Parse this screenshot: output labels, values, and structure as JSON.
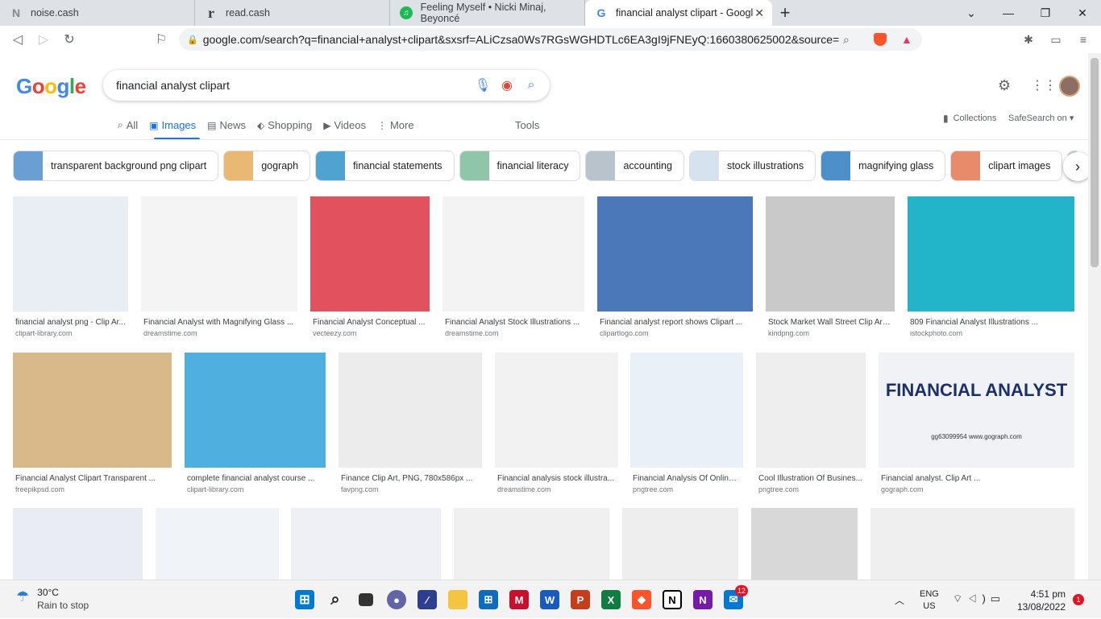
{
  "tabs": [
    {
      "title": "noise.cash",
      "icon": "N"
    },
    {
      "title": "read.cash",
      "icon": "r"
    },
    {
      "title": "Feeling Myself • Nicki Minaj, Beyoncé",
      "icon": "♫"
    },
    {
      "title": "financial analyst clipart - Google S",
      "icon": "G"
    }
  ],
  "url": "google.com/search?q=financial+analyst+clipart&sxsrf=ALiCzsa0Ws7RGsWGHDTLc6EA3gI9jFNEyQ:1660380625002&source=...",
  "search": {
    "logo": "Google",
    "query": "financial analyst clipart"
  },
  "nav": {
    "all": "All",
    "images": "Images",
    "news": "News",
    "shopping": "Shopping",
    "videos": "Videos",
    "more": "More",
    "tools": "Tools"
  },
  "collections": "Collections",
  "safesearch": "SafeSearch on",
  "chips": [
    {
      "label": "transparent background png clipart",
      "color": "#6a9fd4"
    },
    {
      "label": "gograph",
      "color": "#e9b872"
    },
    {
      "label": "financial statements",
      "color": "#4fa3d1"
    },
    {
      "label": "financial literacy",
      "color": "#8fc6a9"
    },
    {
      "label": "accounting",
      "color": "#b9c3cc"
    },
    {
      "label": "stock illustrations",
      "color": "#d6e3ef"
    },
    {
      "label": "magnifying glass",
      "color": "#4c8fc9"
    },
    {
      "label": "clipart images",
      "color": "#e88b6a"
    },
    {
      "label": "",
      "color": "#c8d4dc"
    }
  ],
  "row1": [
    {
      "title": "financial analyst png - Clip Ar...",
      "site": "clipart-library.com",
      "color": "#e8eef3"
    },
    {
      "title": "Financial Analyst with Magnifying Glass ...",
      "site": "dreamstime.com",
      "color": "#f4f4f4"
    },
    {
      "title": "Financial Analyst Conceptual ...",
      "site": "vecteezy.com",
      "color": "#e2525e"
    },
    {
      "title": "Financial Analyst Stock Illustrations ...",
      "site": "dreamstime.com",
      "color": "#f3f3f3"
    },
    {
      "title": "Financial analyst report shows Clipart ...",
      "site": "clipartlogo.com",
      "color": "#4a78b8"
    },
    {
      "title": "Stock Market Wall Street Clip Art,...",
      "site": "kindpng.com",
      "color": "#c9c9c9"
    },
    {
      "title": "809 Financial Analyst Illustrations ...",
      "site": "istockphoto.com",
      "color": "#22b5c9"
    }
  ],
  "row2": [
    {
      "title": "Financial Analyst Clipart Transparent ...",
      "site": "freepikpsd.com",
      "color": "#d9b98a"
    },
    {
      "title": "complete financial analyst course ...",
      "site": "clipart-library.com",
      "color": "#4fb0e0"
    },
    {
      "title": "Finance Clip Art, PNG, 780x586px ...",
      "site": "favpng.com",
      "color": "#ececec"
    },
    {
      "title": "Financial analysis stock illustra...",
      "site": "dreamstime.com",
      "color": "#f2f2f2"
    },
    {
      "title": "Financial Analysis Of Online ...",
      "site": "pngtree.com",
      "color": "#e9f0f7"
    },
    {
      "title": "Cool Illustration Of Busines...",
      "site": "pngtree.com",
      "color": "#eeeeee"
    },
    {
      "title": "Financial analyst. Clip Art ...",
      "site": "gograph.com",
      "color": "#f0f2f6",
      "caption": "FINANCIAL ANALYST",
      "stamp": "gg63099954 www.gograph.com"
    }
  ],
  "row3": [
    {
      "color": "#e9ecf5"
    },
    {
      "color": "#f0f4f8"
    },
    {
      "color": "#eef0f5"
    },
    {
      "color": "#f0f0f0"
    },
    {
      "color": "#eeeeee"
    },
    {
      "color": "#d8d8d8"
    },
    {
      "color": "#efefef"
    }
  ],
  "taskbar": {
    "temp": "30°C",
    "weather": "Rain to stop",
    "lang1": "ENG",
    "lang2": "US",
    "time": "4:51 pm",
    "date": "13/08/2022",
    "notifications": "1",
    "mail_badge": "12"
  }
}
